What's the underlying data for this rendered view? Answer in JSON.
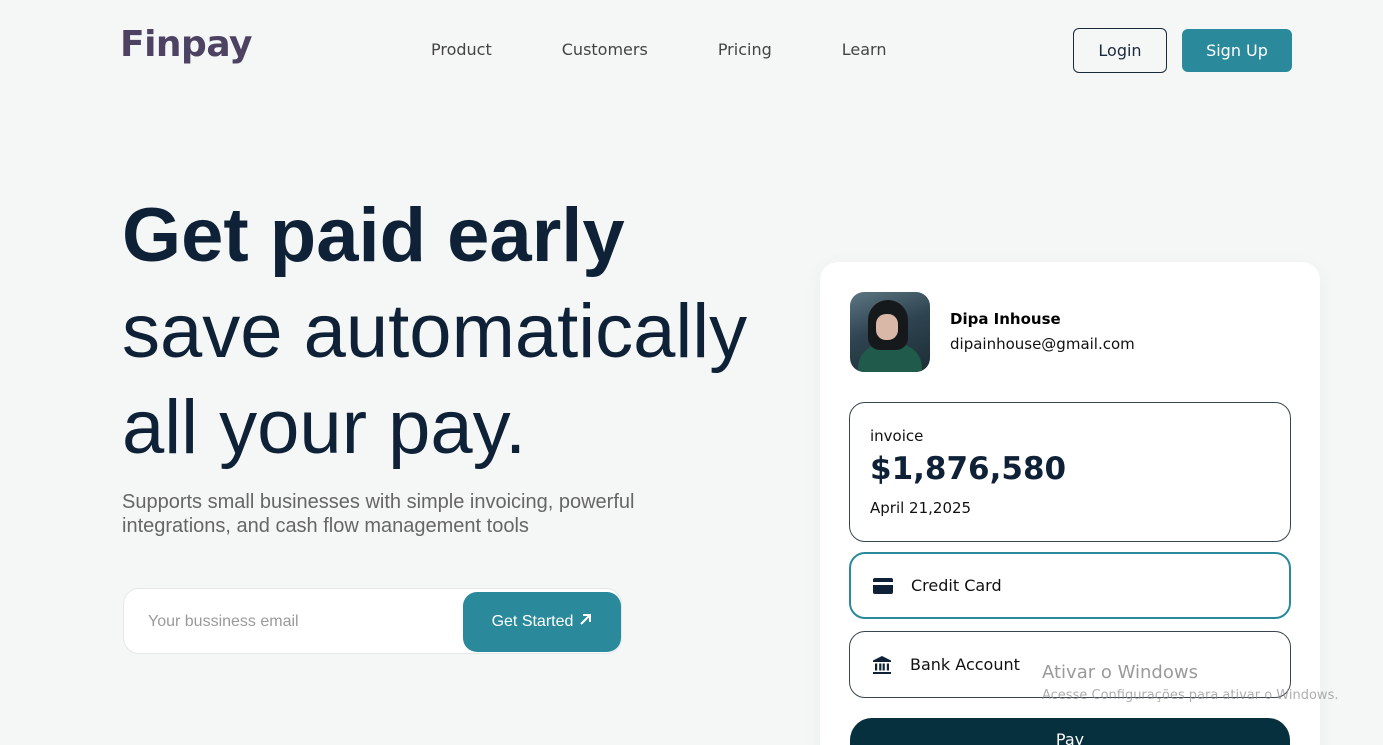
{
  "header": {
    "logo": "Finpay",
    "nav": [
      "Product",
      "Customers",
      "Pricing",
      "Learn"
    ],
    "login_label": "Login",
    "signup_label": "Sign Up"
  },
  "hero": {
    "title_bold": "Get paid early",
    "title_line2": "save automatically",
    "title_line3": "all your pay.",
    "subtitle": "Supports small businesses with simple invoicing, powerful integrations, and cash flow management tools",
    "email_placeholder": "Your bussiness email",
    "cta_label": "Get Started"
  },
  "card": {
    "user_name": "Dipa Inhouse",
    "user_email": "dipainhouse@gmail.com",
    "invoice_label": "invoice",
    "invoice_amount": "$1,876,580",
    "invoice_date": "April 21,2025",
    "payment_options": [
      {
        "label": "Credit Card",
        "icon": "credit-card-icon",
        "selected": true
      },
      {
        "label": "Bank Account",
        "icon": "bank-icon",
        "selected": false
      }
    ],
    "pay_label": "Pay"
  },
  "watermark": {
    "title": "Ativar o Windows",
    "subtitle": "Acesse Configurações para ativar o Windows."
  },
  "colors": {
    "accent": "#2a8a9b",
    "dark": "#0f2137",
    "pay_button": "#07303e",
    "logo": "#4e4263",
    "background": "#f4f7f6"
  }
}
